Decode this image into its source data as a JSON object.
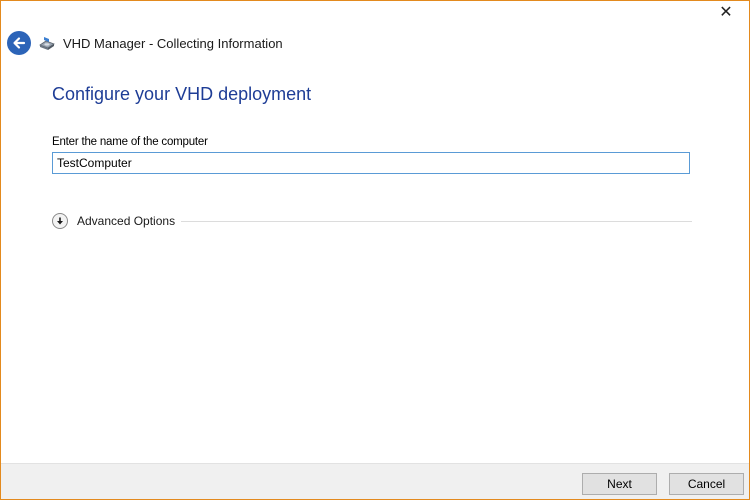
{
  "window": {
    "title": "VHD Manager - Collecting Information",
    "close_glyph": "✕",
    "accent_border": "#e38a1e"
  },
  "icons": {
    "back": "back-arrow-icon",
    "app": "vhd-disk-icon",
    "advanced": "chevron-down-circle-icon"
  },
  "main": {
    "heading": "Configure your VHD deployment",
    "heading_color": "#1e3d96",
    "computer_name": {
      "label": "Enter the name of the computer",
      "value": "TestComputer"
    },
    "advanced_options": {
      "label": "Advanced Options"
    }
  },
  "footer": {
    "next_label": "Next",
    "cancel_label": "Cancel"
  }
}
